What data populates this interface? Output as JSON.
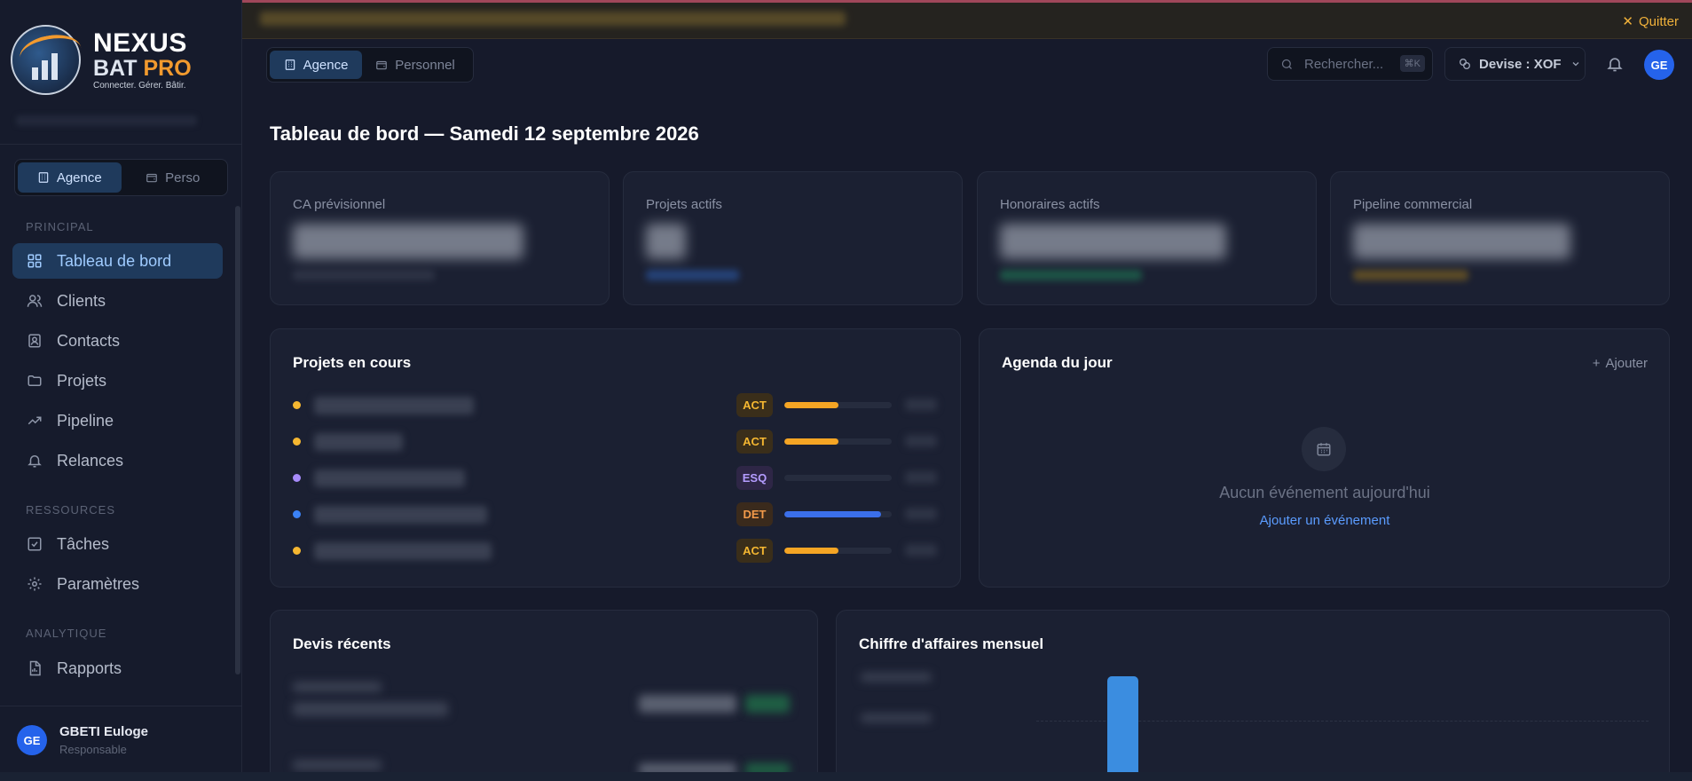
{
  "brand": {
    "name_line1": "NEXUS",
    "name_bat": "BAT",
    "name_pro": "PRO",
    "tagline": "Connecter. Gérer. Bâtir."
  },
  "sidebar": {
    "mode_toggle": {
      "agence": "Agence",
      "perso": "Perso"
    },
    "sections": {
      "principal": "PRINCIPAL",
      "ressources": "RESSOURCES",
      "analytique": "ANALYTIQUE"
    },
    "items": [
      {
        "label": "Tableau de bord",
        "icon": "dashboard-icon",
        "active": true
      },
      {
        "label": "Clients",
        "icon": "users-icon"
      },
      {
        "label": "Contacts",
        "icon": "contacts-icon"
      },
      {
        "label": "Projets",
        "icon": "folder-icon"
      },
      {
        "label": "Pipeline",
        "icon": "trending-up-icon"
      },
      {
        "label": "Relances",
        "icon": "bell-icon"
      },
      {
        "label": "Tâches",
        "icon": "checkbox-icon"
      },
      {
        "label": "Paramètres",
        "icon": "gear-icon"
      },
      {
        "label": "Rapports",
        "icon": "report-icon"
      }
    ],
    "user": {
      "initials": "GE",
      "name": "GBETI Euloge",
      "role": "Responsable"
    }
  },
  "banner": {
    "quit_label": "Quitter"
  },
  "header": {
    "tabs": {
      "agence": "Agence",
      "personnel": "Personnel"
    },
    "search_placeholder": "Rechercher...",
    "search_shortcut": "⌘K",
    "devise_label": "Devise : XOF",
    "avatar_initials": "GE"
  },
  "page": {
    "title": "Tableau de bord — Samedi 12 septembre 2026"
  },
  "kpis": [
    {
      "label": "CA prévisionnel"
    },
    {
      "label": "Projets actifs"
    },
    {
      "label": "Honoraires actifs"
    },
    {
      "label": "Pipeline commercial"
    }
  ],
  "projets": {
    "title": "Projets en cours",
    "rows": [
      {
        "phase": "ACT",
        "progress": 0.5,
        "dot_color": "#f5b731",
        "bar_color": "#f5a524"
      },
      {
        "phase": "ACT",
        "progress": 0.5,
        "dot_color": "#f5b731",
        "bar_color": "#f5a524"
      },
      {
        "phase": "ESQ",
        "progress": 0.0,
        "dot_color": "#a78bfa",
        "bar_color": "#a78bfa"
      },
      {
        "phase": "DET",
        "progress": 0.9,
        "dot_color": "#3b82f6",
        "bar_color": "#3b6fea"
      },
      {
        "phase": "ACT",
        "progress": 0.5,
        "dot_color": "#f5b731",
        "bar_color": "#f5a524"
      }
    ]
  },
  "agenda": {
    "title": "Agenda du jour",
    "add_label": "Ajouter",
    "empty_text": "Aucun événement aujourd'hui",
    "add_event_link": "Ajouter un événement"
  },
  "devis": {
    "title": "Devis récents"
  },
  "ca_mensuel": {
    "title": "Chiffre d'affaires mensuel"
  },
  "colors": {
    "accent": "#1f3a5c",
    "accent_text": "#9fcbff",
    "link": "#5b9cff",
    "warning": "#f0b13a",
    "avatar": "#2563eb"
  }
}
